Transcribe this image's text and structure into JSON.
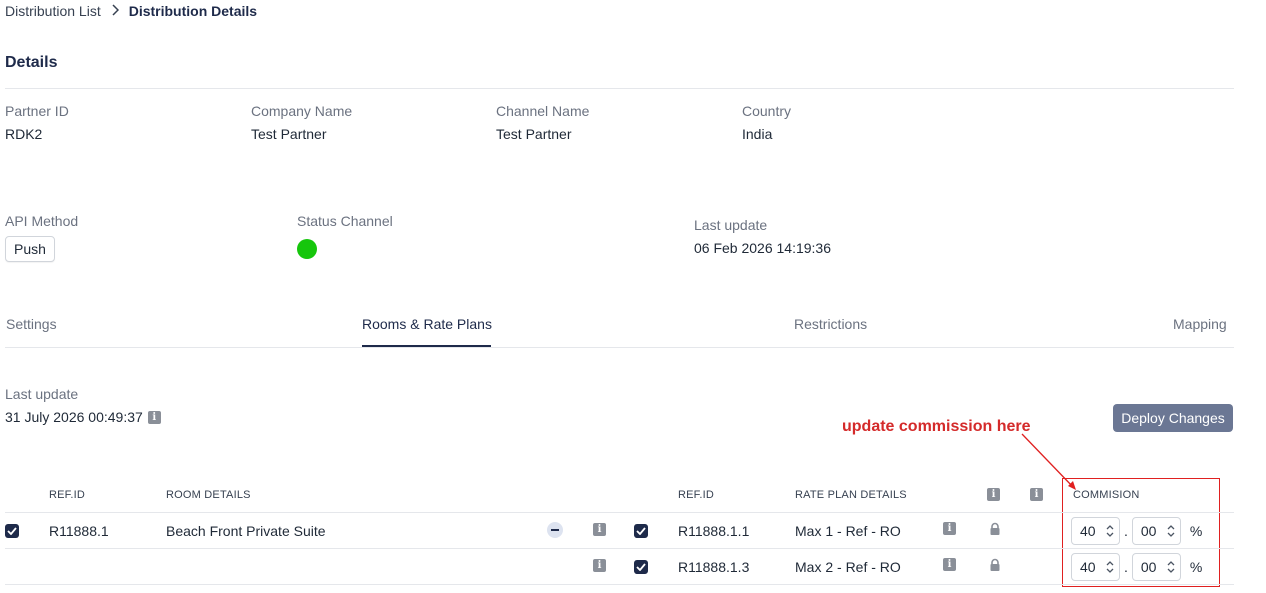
{
  "breadcrumb": {
    "parent": "Distribution List",
    "current": "Distribution Details"
  },
  "details": {
    "heading": "Details",
    "partner_id": {
      "label": "Partner ID",
      "value": "RDK2"
    },
    "company_name": {
      "label": "Company Name",
      "value": "Test Partner"
    },
    "channel_name": {
      "label": "Channel Name",
      "value": "Test Partner"
    },
    "country": {
      "label": "Country",
      "value": "India"
    },
    "api_method": {
      "label": "API Method",
      "value": "Push"
    },
    "status_channel": {
      "label": "Status Channel",
      "color": "#16c60c"
    },
    "last_update": {
      "label": "Last update",
      "value": "06 Feb 2026 14:19:36"
    }
  },
  "tabs": [
    {
      "label": "Settings"
    },
    {
      "label": "Rooms & Rate Plans",
      "active": true
    },
    {
      "label": "Restrictions"
    },
    {
      "label": "Mapping"
    }
  ],
  "rooms": {
    "last_update_label": "Last update",
    "last_update_value": "31 July 2026 00:49:37",
    "deploy_label": "Deploy Changes",
    "headers": {
      "ref_id": "REF.ID",
      "room_details": "ROOM DETAILS",
      "rate_ref_id": "REF.ID",
      "rate_plan_details": "RATE PLAN DETAILS",
      "commission": "COMMISION"
    },
    "rows": [
      {
        "ref_id": "R11888.1",
        "room": "Beach Front Private Suite",
        "rate_ref_id": "R11888.1.1",
        "rate_plan": "Max 1 - Ref - RO",
        "commission_int": "40",
        "commission_dec": "00",
        "unit": "%"
      },
      {
        "ref_id": "",
        "room": "",
        "rate_ref_id": "R11888.1.3",
        "rate_plan": "Max 2 - Ref - RO",
        "commission_int": "40",
        "commission_dec": "00",
        "unit": "%"
      }
    ]
  },
  "annotation": {
    "text": "update commission here",
    "color": "#d42a2a"
  }
}
